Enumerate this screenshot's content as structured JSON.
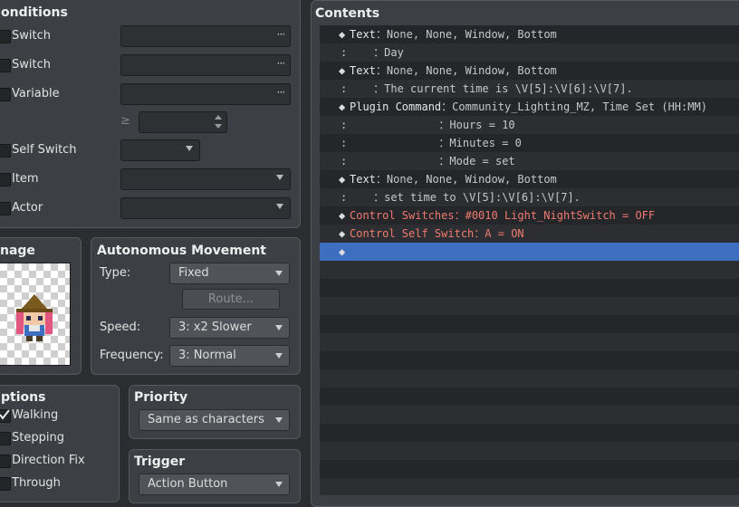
{
  "conditions": {
    "title": "onditions",
    "switch1_label": "Switch",
    "switch2_label": "Switch",
    "variable_label": "Variable",
    "ge_symbol": "≥",
    "self_switch_label": "Self Switch",
    "item_label": "Item",
    "actor_label": "Actor"
  },
  "image": {
    "title": "nage"
  },
  "movement": {
    "title": "Autonomous Movement",
    "type_label": "Type:",
    "type_value": "Fixed",
    "route_button": "Route...",
    "speed_label": "Speed:",
    "speed_value": "3: x2 Slower",
    "frequency_label": "Frequency:",
    "frequency_value": "3: Normal"
  },
  "options": {
    "title": "ptions",
    "walking_label": "Walking",
    "walking_checked": true,
    "stepping_label": "Stepping",
    "direction_fix_label": "Direction Fix",
    "through_label": "Through"
  },
  "priority": {
    "title": "Priority",
    "value": "Same as characters"
  },
  "trigger": {
    "title": "Trigger",
    "value": "Action Button"
  },
  "contents": {
    "title": "Contents",
    "rows": [
      {
        "diamond": "◆",
        "name": "Text",
        "sep": "：",
        "text": "None, None, Window, Bottom",
        "color": "normal"
      },
      {
        "cont": ":",
        "indent": "    ",
        "sep": "：",
        "text": "Day",
        "color": "normal"
      },
      {
        "diamond": "◆",
        "name": "Text",
        "sep": "：",
        "text": "None, None, Window, Bottom",
        "color": "normal"
      },
      {
        "cont": ":",
        "indent": "    ",
        "sep": "：",
        "text": "The current time is \\V[5]:\\V[6]:\\V[7].",
        "color": "normal"
      },
      {
        "diamond": "◆",
        "name": "Plugin Command",
        "sep": "：",
        "text": "Community_Lighting_MZ, Time Set (HH:MM)",
        "color": "normal"
      },
      {
        "cont": ":",
        "indent": "              ",
        "sep": "：",
        "text": "Hours = 10",
        "color": "normal"
      },
      {
        "cont": ":",
        "indent": "              ",
        "sep": "：",
        "text": "Minutes = 0",
        "color": "normal"
      },
      {
        "cont": ":",
        "indent": "              ",
        "sep": "：",
        "text": "Mode = set",
        "color": "normal"
      },
      {
        "diamond": "◆",
        "name": "Text",
        "sep": "：",
        "text": "None, None, Window, Bottom",
        "color": "normal"
      },
      {
        "cont": ":",
        "indent": "    ",
        "sep": "：",
        "text": "set time to \\V[5]:\\V[6]:\\V[7].",
        "color": "normal"
      },
      {
        "diamond": "◆",
        "name": "Control Switches",
        "sep": "：",
        "text": "#0010 Light_NightSwitch = OFF",
        "color": "red"
      },
      {
        "diamond": "◆",
        "name": "Control Self Switch",
        "sep": "：",
        "text": "A = ON",
        "color": "red"
      },
      {
        "diamond": "◆",
        "name": "",
        "sep": "",
        "text": "",
        "color": "normal",
        "selected": true
      }
    ]
  }
}
